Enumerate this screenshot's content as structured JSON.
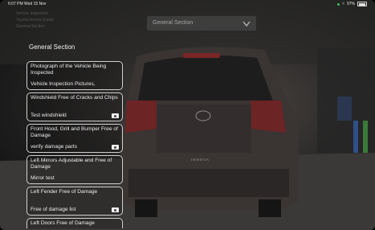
{
  "status_bar": {
    "time": "6:07 PM  Wed 15 Nov",
    "battery": "97%"
  },
  "header": {
    "faint_lines": [
      "Vehicle Inspection",
      "Toyota Innova Crysta",
      "General Section"
    ],
    "dropdown_value": "General Section"
  },
  "panel": {
    "section_title": "General Section",
    "items": [
      {
        "title": "Photograph of the Vehicle Being Inspected",
        "subtitle": "Vehicle Inspection Pictures,",
        "has_camera": false
      },
      {
        "title": "Windshield Free of Cracks and Chips",
        "subtitle": "Test windshield",
        "has_camera": true
      },
      {
        "title": "Front Hood, Grill and Bumper Free of Damage",
        "subtitle": "verify damage parts",
        "has_camera": true
      },
      {
        "title": "Left Mirrors Adjustable and Free of Damage",
        "subtitle": "Mirror test",
        "has_camera": false
      },
      {
        "title": "Left Fender Free of Damage",
        "subtitle": "Free of damage list",
        "has_camera": true
      },
      {
        "title": "Left Doors Free of Damage",
        "subtitle": "",
        "has_camera": false
      }
    ]
  },
  "scene": {
    "badge_text": "INNOVA"
  },
  "colors": {
    "accent_green": "#3ec15a",
    "card_border": "#cfcfcf"
  }
}
